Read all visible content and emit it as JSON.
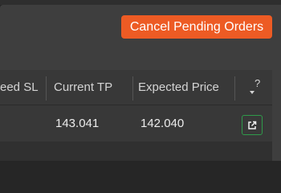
{
  "toolbar": {
    "cancel_pending_label": "Cancel Pending Orders"
  },
  "table": {
    "columns": [
      {
        "key": "fixed_sl",
        "label": "eed SL"
      },
      {
        "key": "current_tp",
        "label": "Current TP"
      },
      {
        "key": "expected_price",
        "label": "Expected Price"
      },
      {
        "key": "help",
        "label": "?"
      }
    ],
    "rows": [
      {
        "current_tp": "143.041",
        "expected_price": "142.040",
        "action_icon": "external-link-icon"
      }
    ]
  },
  "colors": {
    "accent": "#ed5b24",
    "action_border": "#2f9a4a",
    "panel": "#3e3e3e"
  }
}
